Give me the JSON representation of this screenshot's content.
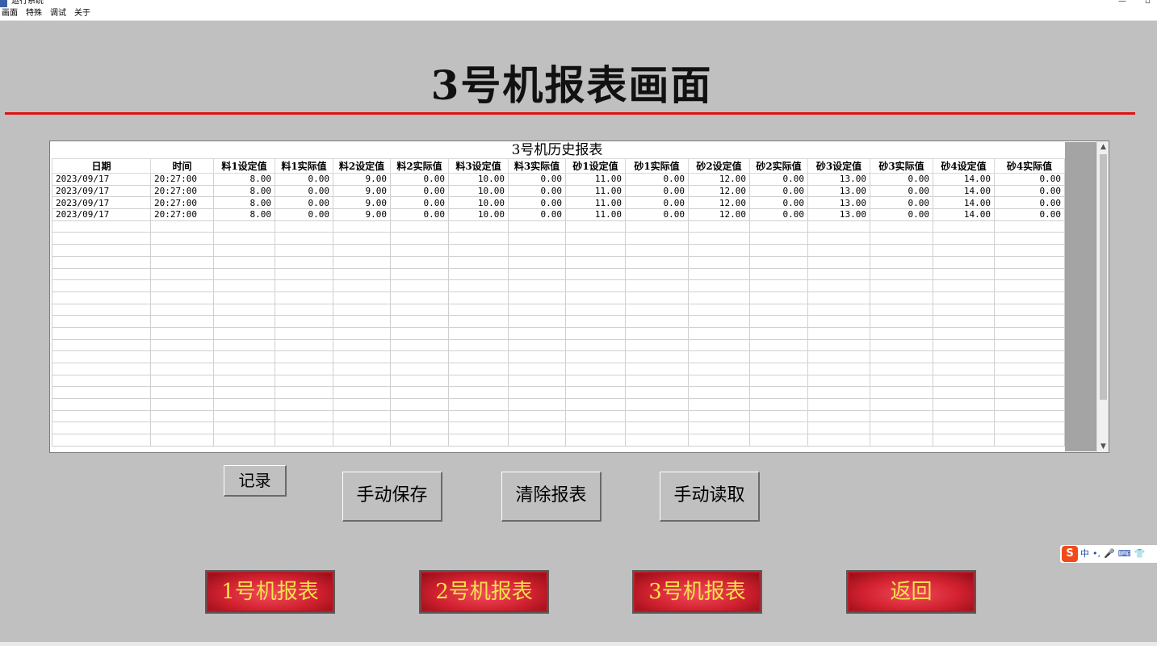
{
  "window": {
    "title": "运行系统",
    "minimize_glyph": "—",
    "restore_glyph": "▫"
  },
  "menu": [
    "画面",
    "特殊",
    "调试",
    "关于"
  ],
  "page_title": "3号机报表画面",
  "report": {
    "caption": "3号机历史报表",
    "columns": [
      "日期",
      "时间",
      "料1设定值",
      "料1实际值",
      "料2设定值",
      "料2实际值",
      "料3设定值",
      "料3实际值",
      "砂1设定值",
      "砂1实际值",
      "砂2设定值",
      "砂2实际值",
      "砂3设定值",
      "砂3实际值",
      "砂4设定值",
      "砂4实际值"
    ],
    "rows": [
      [
        "2023/09/17",
        "20:27:00",
        "8.00",
        "0.00",
        "9.00",
        "0.00",
        "10.00",
        "0.00",
        "11.00",
        "0.00",
        "12.00",
        "0.00",
        "13.00",
        "0.00",
        "14.00",
        "0.00"
      ],
      [
        "2023/09/17",
        "20:27:00",
        "8.00",
        "0.00",
        "9.00",
        "0.00",
        "10.00",
        "0.00",
        "11.00",
        "0.00",
        "12.00",
        "0.00",
        "13.00",
        "0.00",
        "14.00",
        "0.00"
      ],
      [
        "2023/09/17",
        "20:27:00",
        "8.00",
        "0.00",
        "9.00",
        "0.00",
        "10.00",
        "0.00",
        "11.00",
        "0.00",
        "12.00",
        "0.00",
        "13.00",
        "0.00",
        "14.00",
        "0.00"
      ],
      [
        "2023/09/17",
        "20:27:00",
        "8.00",
        "0.00",
        "9.00",
        "0.00",
        "10.00",
        "0.00",
        "11.00",
        "0.00",
        "12.00",
        "0.00",
        "13.00",
        "0.00",
        "14.00",
        "0.00"
      ]
    ],
    "scroll_up_glyph": "▲",
    "scroll_down_glyph": "▼"
  },
  "actions": {
    "record": "记录",
    "manual_save": "手动保存",
    "clear_report": "清除报表",
    "manual_read": "手动读取"
  },
  "nav": {
    "report1": "1号机报表",
    "report2": "2号机报表",
    "report3": "3号机报表",
    "back": "返回"
  },
  "ime": {
    "logo": "S",
    "lang": "中",
    "punct": "•,",
    "mic": "🎤",
    "keyboard": "⌨",
    "skin": "👕"
  },
  "colors": {
    "background": "#c0c0c0",
    "title_line": "#e01010",
    "nav_button": "#d0202f",
    "nav_text": "#f3e24a"
  }
}
